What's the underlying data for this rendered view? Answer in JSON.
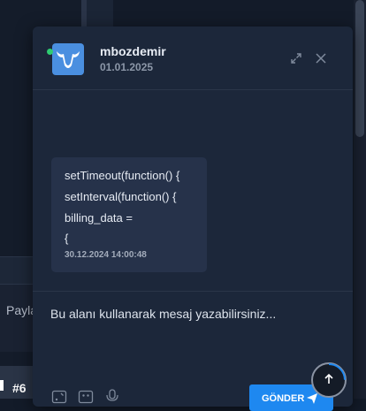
{
  "background": {
    "left_tab_text": "Payla",
    "badge_text": "#6"
  },
  "chat": {
    "user": {
      "name": "mbozdemir",
      "date": "01.01.2025",
      "online": true,
      "avatar_icon": "bull-logo-icon"
    },
    "header_actions": [
      "expand-icon",
      "close-icon"
    ],
    "messages": [
      {
        "lines": [
          "setTimeout(function() {",
          "setInterval(function() {",
          "billing_data =",
          "{"
        ],
        "time": "30.12.2024 14:00:48"
      }
    ],
    "composer": {
      "placeholder": "Bu alanı kullanarak mesaj yazabilirsiniz...",
      "toolbar_icons": [
        "attachment-icon",
        "emoji-icon",
        "microphone-icon"
      ],
      "send_label": "GÖNDER",
      "send_icon": "paper-plane-icon"
    }
  },
  "colors": {
    "accent": "#1e88f0",
    "online": "#2ecc71",
    "panel": "#1c273a",
    "bubble": "#26324a"
  }
}
